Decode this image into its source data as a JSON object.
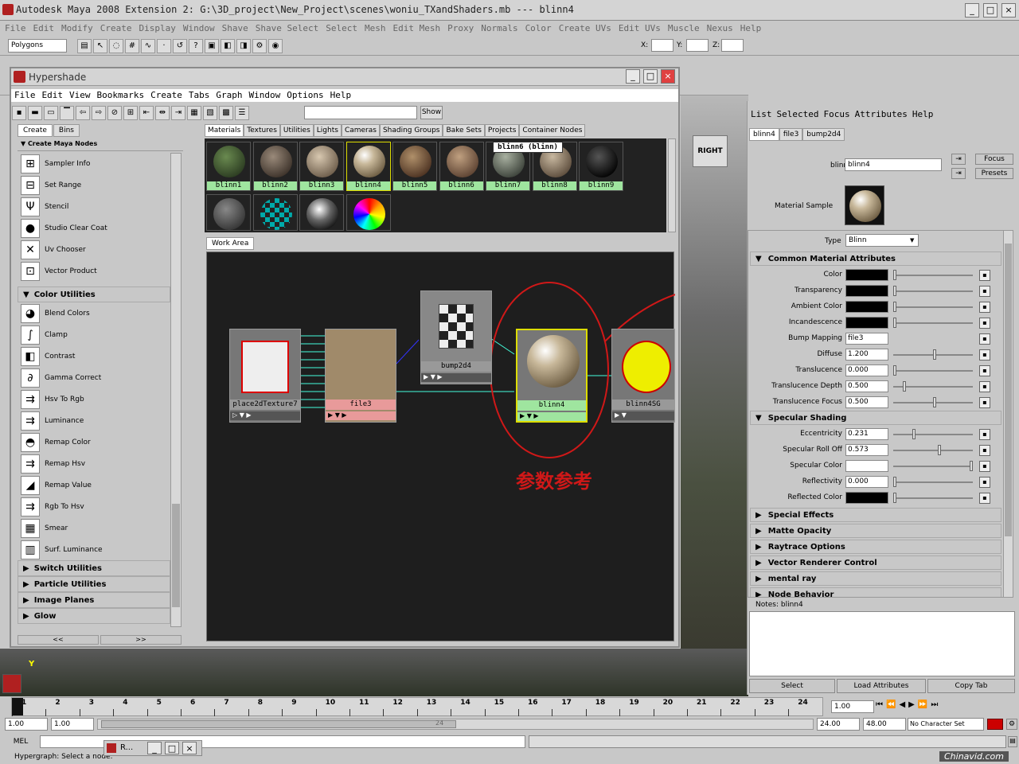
{
  "window": {
    "title": "Autodesk Maya 2008 Extension 2: G:\\3D_project\\New_Project\\scenes\\woniu_TXandShaders.mb    ---    blinn4"
  },
  "menubar": [
    "File",
    "Edit",
    "Modify",
    "Create",
    "Display",
    "Window",
    "Shave",
    "Shave Select",
    "Select",
    "Mesh",
    "Edit Mesh",
    "Proxy",
    "Normals",
    "Color",
    "Create UVs",
    "Edit UVs",
    "Muscle",
    "Nexus",
    "Help"
  ],
  "status": {
    "mode": "Polygons",
    "x_label": "X:",
    "y_label": "Y:",
    "z_label": "Z:"
  },
  "hypershade": {
    "title": "Hypershade",
    "menu": [
      "File",
      "Edit",
      "View",
      "Bookmarks",
      "Create",
      "Tabs",
      "Graph",
      "Window",
      "Options",
      "Help"
    ],
    "show_label": "Show",
    "left_tabs": [
      "Create",
      "Bins"
    ],
    "create_header": "Create Maya Nodes",
    "node_items": [
      "Sampler Info",
      "Set Range",
      "Stencil",
      "Studio Clear Coat",
      "Uv Chooser",
      "Vector Product"
    ],
    "color_utilities_header": "Color Utilities",
    "color_items": [
      "Blend Colors",
      "Clamp",
      "Contrast",
      "Gamma Correct",
      "Hsv To Rgb",
      "Luminance",
      "Remap Color",
      "Remap Hsv",
      "Remap Value",
      "Rgb To Hsv",
      "Smear",
      "Surf. Luminance"
    ],
    "collapsed_sections": [
      "Switch Utilities",
      "Particle Utilities",
      "Image Planes",
      "Glow"
    ],
    "nav_left": "<<",
    "nav_right": ">>",
    "top_tabs": [
      "Materials",
      "Textures",
      "Utilities",
      "Lights",
      "Cameras",
      "Shading Groups",
      "Bake Sets",
      "Projects",
      "Container Nodes"
    ],
    "materials": [
      "blinn1",
      "blinn2",
      "blinn3",
      "blinn4",
      "blinn5",
      "blinn6",
      "blinn7",
      "blinn8",
      "blinn9"
    ],
    "tooltip": "blinn6 (blinn)",
    "work_area_tab": "Work Area",
    "graph_nodes": {
      "place2d": "place2dTexture7",
      "file": "file3",
      "bump": "bump2d4",
      "blinn": "blinn4",
      "sg": "blinn4SG"
    },
    "annotation": "参数参考"
  },
  "attribute_editor": {
    "menu": [
      "List",
      "Selected",
      "Focus",
      "Attributes",
      "Help"
    ],
    "tabs": [
      "blinn4",
      "file3",
      "bump2d4"
    ],
    "node_label": "blinn:",
    "node_value": "blinn4",
    "focus_button": "Focus",
    "presets_button": "Presets",
    "material_sample_label": "Material Sample",
    "type_label": "Type",
    "type_value": "Blinn",
    "common_header": "Common Material Attributes",
    "common_attrs": [
      {
        "name": "Color",
        "value": ""
      },
      {
        "name": "Transparency",
        "value": ""
      },
      {
        "name": "Ambient Color",
        "value": ""
      },
      {
        "name": "Incandescence",
        "value": ""
      },
      {
        "name": "Bump Mapping",
        "value": "file3"
      },
      {
        "name": "Diffuse",
        "value": "1.200"
      },
      {
        "name": "Translucence",
        "value": "0.000"
      },
      {
        "name": "Translucence Depth",
        "value": "0.500"
      },
      {
        "name": "Translucence Focus",
        "value": "0.500"
      }
    ],
    "specular_header": "Specular Shading",
    "specular_attrs": [
      {
        "name": "Eccentricity",
        "value": "0.231"
      },
      {
        "name": "Specular Roll Off",
        "value": "0.573"
      },
      {
        "name": "Specular Color",
        "value": ""
      },
      {
        "name": "Reflectivity",
        "value": "0.000"
      },
      {
        "name": "Reflected Color",
        "value": ""
      }
    ],
    "collapsed_sections": [
      "Special Effects",
      "Matte Opacity",
      "Raytrace Options",
      "Vector Renderer Control",
      "mental ray",
      "Node Behavior"
    ],
    "notes_label": "Notes:  blinn4",
    "buttons": [
      "Select",
      "Load Attributes",
      "Copy Tab"
    ]
  },
  "timeline": {
    "frames": [
      "1",
      "2",
      "3",
      "4",
      "5",
      "6",
      "7",
      "8",
      "9",
      "10",
      "11",
      "12",
      "13",
      "14",
      "15",
      "16",
      "17",
      "18",
      "19",
      "20",
      "21",
      "22",
      "23",
      "24"
    ],
    "current": "1.00"
  },
  "range": {
    "start": "1.00",
    "start2": "1.00",
    "mid": "24",
    "end": "24.00",
    "end2": "48.00",
    "char_set": "No Character Set"
  },
  "cmd": {
    "label": "MEL"
  },
  "help": {
    "text": "Hypergraph: Select a node.",
    "minimized": "R..."
  },
  "watermark": "Chinavid.com"
}
